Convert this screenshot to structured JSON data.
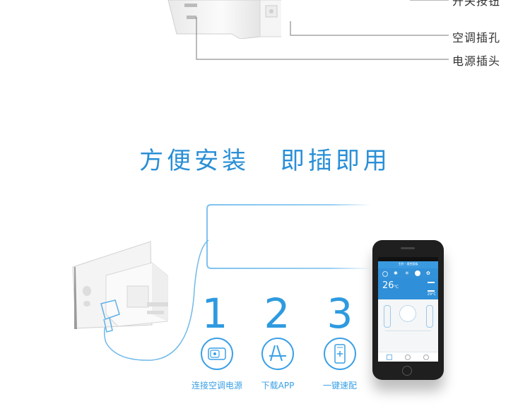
{
  "callouts": {
    "top_partial": "开关按钮",
    "ac_socket": "空调插孔",
    "power_plug": "电源插头"
  },
  "headline": {
    "part1": "方便安装",
    "part2": "即插即用"
  },
  "steps": [
    {
      "number": "1",
      "label": "连接空调电源",
      "icon": "plug-socket-icon"
    },
    {
      "number": "2",
      "label": "下载APP",
      "icon": "app-store-icon"
    },
    {
      "number": "3",
      "label": "一键速配",
      "icon": "smartphone-plus-icon"
    }
  ],
  "phone": {
    "temperature": "26",
    "temperature_unit": "℃",
    "room_temp": "29°C",
    "title": "主卧 - 遥控面板"
  },
  "colors": {
    "accent": "#2a8fd6",
    "line_blue": "#6fb9ea"
  }
}
